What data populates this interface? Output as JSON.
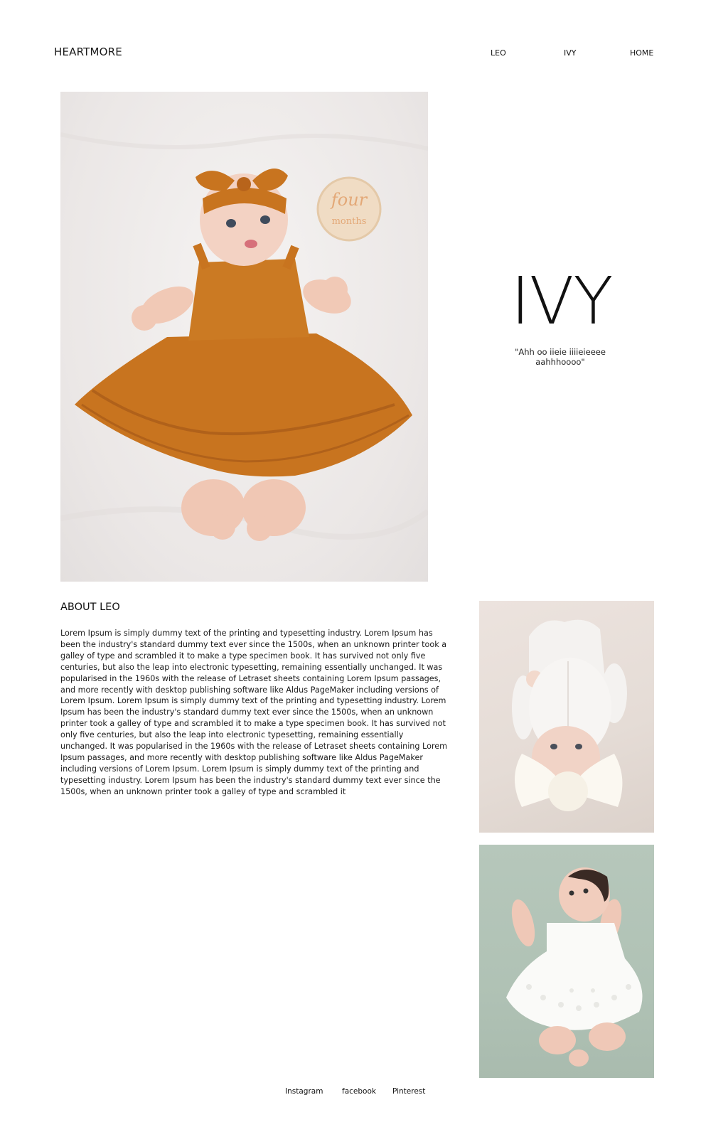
{
  "header": {
    "brand": "HEARTMORE",
    "nav": [
      {
        "label": "LEO"
      },
      {
        "label": "IVY"
      },
      {
        "label": "HOME"
      }
    ]
  },
  "hero": {
    "title": "IVY",
    "quote": "\"Ahh oo iieie iiiieieeee aahhhoooo\"",
    "milestone_sign": {
      "line1": "four",
      "line2": "months"
    }
  },
  "about": {
    "heading": "ABOUT LEO",
    "body": "Lorem Ipsum is simply dummy text of the printing and typesetting industry. Lorem Ipsum has been the industry's standard dummy text ever since the 1500s, when an unknown printer took a galley of type and scrambled it to make a type specimen book. It has survived not only five centuries, but also the leap into electronic typesetting, remaining essentially unchanged. It was popularised in the 1960s with the release of Letraset sheets containing Lorem Ipsum passages, and more recently with desktop publishing software like Aldus PageMaker including versions of Lorem Ipsum. Lorem Ipsum is simply dummy text of the printing and typesetting industry. Lorem Ipsum has been the industry's standard dummy text ever since the 1500s, when an unknown printer took a galley of type and scrambled it to make a type specimen book. It has survived not only five centuries, but also the leap into electronic typesetting, remaining essentially unchanged. It was popularised in the 1960s with the release of Letraset sheets containing Lorem Ipsum passages, and more recently with desktop publishing software like Aldus PageMaker including versions of Lorem Ipsum. Lorem Ipsum is simply dummy text of the printing and typesetting industry. Lorem Ipsum has been the industry's standard dummy text ever since the 1500s, when an unknown printer took a galley of type and scrambled it"
  },
  "footer": {
    "links": [
      {
        "label": "Instagram"
      },
      {
        "label": "facebook"
      },
      {
        "label": "Pinterest"
      }
    ]
  },
  "colors": {
    "background": "#ffffff",
    "text": "#111111",
    "dress_orange": "#c8741f",
    "sage_backdrop": "#b3c4b8"
  }
}
